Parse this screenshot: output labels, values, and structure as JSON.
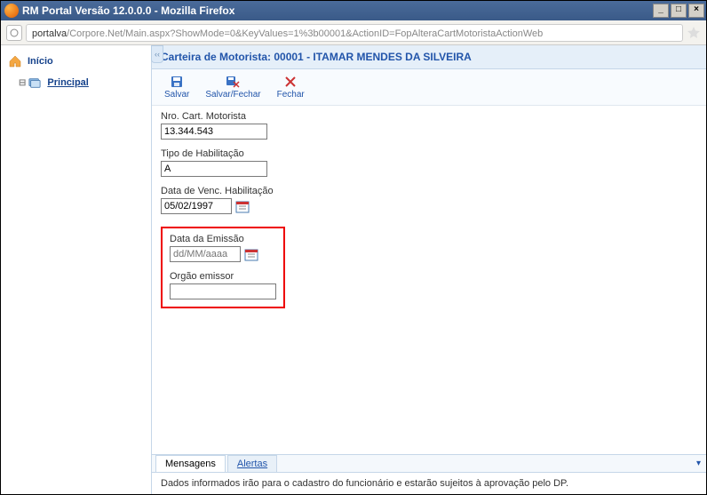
{
  "window": {
    "title": "RM Portal Versão 12.0.0.0 - Mozilla Firefox"
  },
  "urlbar": {
    "host": "portalva",
    "path": "/Corpore.Net/Main.aspx?ShowMode=0&KeyValues=1%3b00001&ActionID=FopAlteraCartMotoristaActionWeb"
  },
  "sidebar": {
    "inicio": "Início",
    "principal": "Principal"
  },
  "header": {
    "title": "Carteira de Motorista: 00001 - ITAMAR MENDES DA SILVEIRA"
  },
  "toolbar": {
    "salvar": "Salvar",
    "salvar_fechar": "Salvar/Fechar",
    "fechar": "Fechar"
  },
  "form": {
    "nro_label": "Nro. Cart. Motorista",
    "nro_value": "13.344.543",
    "tipo_label": "Tipo de Habilitação",
    "tipo_value": "A",
    "venc_label": "Data de Venc. Habilitação",
    "venc_value": "05/02/1997",
    "emissao_label": "Data da Emissão",
    "emissao_placeholder": "dd/MM/aaaa",
    "orgao_label": "Orgão emissor",
    "orgao_value": ""
  },
  "tabs": {
    "mensagens": "Mensagens",
    "alertas": "Alertas"
  },
  "status": {
    "message": "Dados informados irão para o cadastro do funcionário e estarão sujeitos à aprovação pelo DP."
  }
}
